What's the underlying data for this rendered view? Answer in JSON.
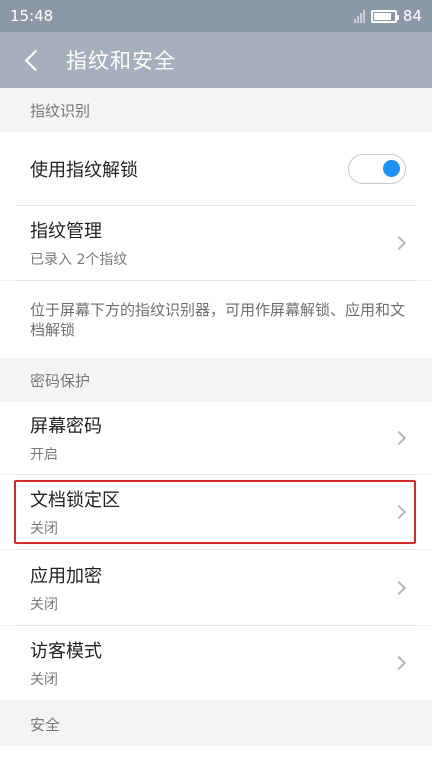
{
  "status": {
    "time": "15:48",
    "battery": "84",
    "battery_level_percent": 84
  },
  "header": {
    "title": "指纹和安全",
    "back_icon": "back-arrow-icon"
  },
  "sections": {
    "fingerprint": {
      "header": "指纹识别",
      "unlock_label": "使用指纹解锁",
      "unlock_toggle_on": true,
      "manage_label": "指纹管理",
      "manage_sub": "已录入 2个指纹",
      "description": "位于屏幕下方的指纹识别器，可用作屏幕解锁、应用和文档解锁"
    },
    "password": {
      "header": "密码保护",
      "items": [
        {
          "label": "屏幕密码",
          "status": "开启"
        },
        {
          "label": "文档锁定区",
          "status": "关闭"
        },
        {
          "label": "应用加密",
          "status": "关闭"
        },
        {
          "label": "访客模式",
          "status": "关闭"
        }
      ]
    },
    "security": {
      "header": "安全"
    }
  },
  "colors": {
    "toggle_accent": "#1e8ff5",
    "highlight_border": "#d12b2b",
    "app_bar": "#a6b0bc"
  }
}
